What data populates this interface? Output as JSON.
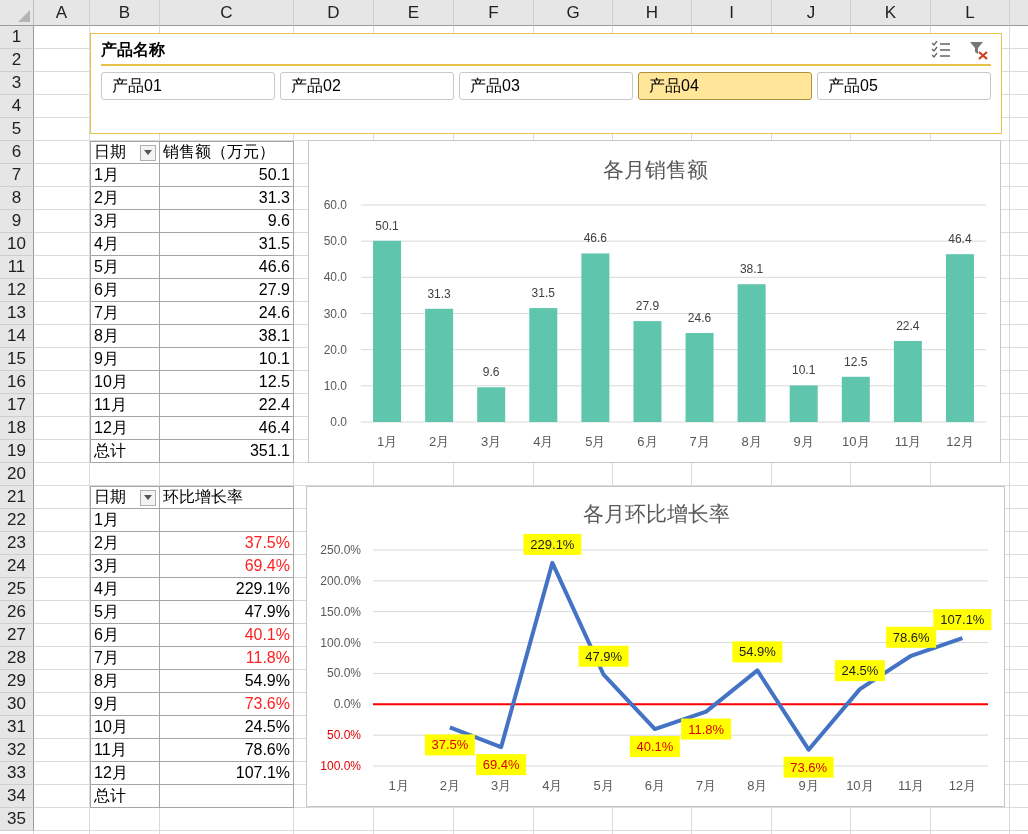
{
  "column_headers": [
    "A",
    "B",
    "C",
    "D",
    "E",
    "F",
    "G",
    "H",
    "I",
    "J",
    "K",
    "L"
  ],
  "row_numbers": [
    "1",
    "2",
    "3",
    "4",
    "5",
    "6",
    "7",
    "8",
    "9",
    "10",
    "11",
    "12",
    "13",
    "14",
    "15",
    "16",
    "17",
    "18",
    "19",
    "20",
    "21",
    "22",
    "23",
    "24",
    "25",
    "26",
    "27",
    "28",
    "29",
    "30",
    "31",
    "32",
    "33",
    "34",
    "35"
  ],
  "slicer": {
    "title": "产品名称",
    "items": [
      {
        "label": "产品01",
        "selected": false
      },
      {
        "label": "产品02",
        "selected": false
      },
      {
        "label": "产品03",
        "selected": false
      },
      {
        "label": "产品04",
        "selected": true
      },
      {
        "label": "产品05",
        "selected": false
      }
    ]
  },
  "sales_table": {
    "columns": [
      "日期",
      "销售额（万元）"
    ],
    "rows": [
      {
        "month": "1月",
        "value": "50.1"
      },
      {
        "month": "2月",
        "value": "31.3"
      },
      {
        "month": "3月",
        "value": "9.6"
      },
      {
        "month": "4月",
        "value": "31.5"
      },
      {
        "month": "5月",
        "value": "46.6"
      },
      {
        "month": "6月",
        "value": "27.9"
      },
      {
        "month": "7月",
        "value": "24.6"
      },
      {
        "month": "8月",
        "value": "38.1"
      },
      {
        "month": "9月",
        "value": "10.1"
      },
      {
        "month": "10月",
        "value": "12.5"
      },
      {
        "month": "11月",
        "value": "22.4"
      },
      {
        "month": "12月",
        "value": "46.4"
      }
    ],
    "total": {
      "label": "总计",
      "value": "351.1"
    }
  },
  "growth_table": {
    "columns": [
      "日期",
      "环比增长率"
    ],
    "rows": [
      {
        "month": "1月"
      },
      {
        "month": "2月",
        "value": "37.5%",
        "negative": true
      },
      {
        "month": "3月",
        "value": "69.4%",
        "negative": true
      },
      {
        "month": "4月",
        "value": "229.1%",
        "negative": false
      },
      {
        "month": "5月",
        "value": "47.9%",
        "negative": false
      },
      {
        "month": "6月",
        "value": "40.1%",
        "negative": true
      },
      {
        "month": "7月",
        "value": "11.8%",
        "negative": true
      },
      {
        "month": "8月",
        "value": "54.9%",
        "negative": false
      },
      {
        "month": "9月",
        "value": "73.6%",
        "negative": true
      },
      {
        "month": "10月",
        "value": "24.5%",
        "negative": false
      },
      {
        "month": "11月",
        "value": "78.6%",
        "negative": false
      },
      {
        "month": "12月",
        "value": "107.1%",
        "negative": false
      }
    ],
    "total": {
      "label": "总计"
    }
  },
  "sales_chart": {
    "chart_data": {
      "type": "bar",
      "title": "各月销售额",
      "categories": [
        "1月",
        "2月",
        "3月",
        "4月",
        "5月",
        "6月",
        "7月",
        "8月",
        "9月",
        "10月",
        "11月",
        "12月"
      ],
      "ylim": [
        0,
        60
      ],
      "grid": true,
      "yticks": [
        {
          "value": 0,
          "label": "0.0"
        },
        {
          "value": 10,
          "label": "10.0"
        },
        {
          "value": 20,
          "label": "20.0"
        },
        {
          "value": 30,
          "label": "30.0"
        },
        {
          "value": 40,
          "label": "40.0"
        },
        {
          "value": 50,
          "label": "50.0"
        },
        {
          "value": 60,
          "label": "60.0"
        }
      ],
      "series": [
        {
          "color": "#5fc5ad",
          "values": [
            50.1,
            31.3,
            9.6,
            31.5,
            46.6,
            27.9,
            24.6,
            38.1,
            10.1,
            12.5,
            22.4,
            46.4
          ]
        }
      ],
      "data_labels": true
    }
  },
  "growth_chart": {
    "chart_data": {
      "type": "line",
      "title": "各月环比增长率",
      "categories": [
        "1月",
        "2月",
        "3月",
        "4月",
        "5月",
        "6月",
        "7月",
        "8月",
        "9月",
        "10月",
        "11月",
        "12月"
      ],
      "ylim": [
        -100,
        250
      ],
      "grid": true,
      "yticks": [
        {
          "value": -100,
          "label": "100.0%"
        },
        {
          "value": -50,
          "label": "50.0%"
        },
        {
          "value": 0,
          "label": "0.0%"
        },
        {
          "value": 50,
          "label": "50.0%"
        },
        {
          "value": 100,
          "label": "100.0%"
        },
        {
          "value": 150,
          "label": "150.0%"
        },
        {
          "value": 200,
          "label": "200.0%"
        },
        {
          "value": 250,
          "label": "250.0%"
        }
      ],
      "series": [
        {
          "color": "#4472c4",
          "values": [
            null,
            -37.5,
            -69.4,
            229.1,
            47.9,
            -40.1,
            -11.8,
            54.9,
            -73.6,
            24.5,
            78.6,
            107.1
          ]
        }
      ],
      "value_labels": [
        null,
        "37.5%",
        "69.4%",
        "229.1%",
        "47.9%",
        "40.1%",
        "11.8%",
        "54.9%",
        "73.6%",
        "24.5%",
        "78.6%",
        "107.1%"
      ],
      "ref_lines": [
        {
          "axis": "y",
          "value": 0,
          "color": "#ff0000"
        }
      ]
    }
  }
}
